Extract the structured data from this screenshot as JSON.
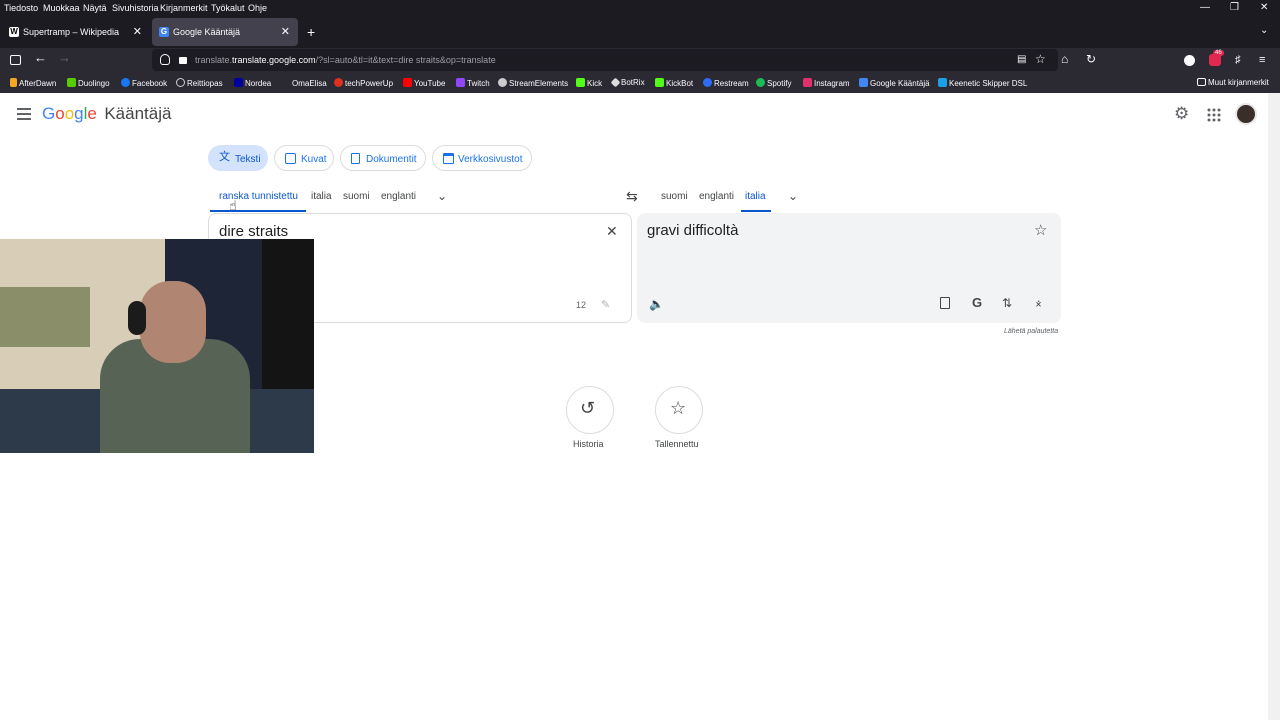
{
  "menubar": {
    "items": [
      "Tiedosto",
      "Muokkaa",
      "Näytä",
      "Sivuhistoria",
      "Kirjanmerkit",
      "Työkalut",
      "Ohje"
    ]
  },
  "tabs": [
    {
      "title": "Supertramp – Wikipedia",
      "favicon": "W"
    },
    {
      "title": "Google Kääntäjä",
      "favicon": "G"
    }
  ],
  "url": {
    "host": "translate.google.com",
    "path": "/?sl=auto&tl=it&text=dire straits&op=translate",
    "prefix": "translate."
  },
  "extension_badge": "46",
  "bookmarks": [
    {
      "label": "AfterDawn",
      "color": "#f5a623"
    },
    {
      "label": "Duolingo",
      "color": "#58cc02"
    },
    {
      "label": "Facebook",
      "color": "#1877f2"
    },
    {
      "label": "Reittiopas",
      "color": "#cfcfcf"
    },
    {
      "label": "Nordea",
      "color": "#0000a0"
    },
    {
      "label": "OmaElisa",
      "color": "#2b2a33"
    },
    {
      "label": "techPowerUp",
      "color": "#e0301e"
    },
    {
      "label": "YouTube",
      "color": "#ff0000"
    },
    {
      "label": "Twitch",
      "color": "#9146ff"
    },
    {
      "label": "StreamElements",
      "color": "#cccccc"
    },
    {
      "label": "Kick",
      "color": "#53fc18"
    },
    {
      "label": "BotRix",
      "color": "#dddddd"
    },
    {
      "label": "KickBot",
      "color": "#53fc18"
    },
    {
      "label": "Restream",
      "color": "#2f6cf6"
    },
    {
      "label": "Spotify",
      "color": "#1db954"
    },
    {
      "label": "Instagram",
      "color": "#e1306c"
    },
    {
      "label": "Google Kääntäjä",
      "color": "#4285f4"
    },
    {
      "label": "Keenetic Skipper DSL",
      "color": "#1aa0e6"
    }
  ],
  "other_bookmarks": "Muut kirjanmerkit",
  "app": {
    "logo_letters": [
      "G",
      "o",
      "o",
      "g",
      "l",
      "e"
    ],
    "logo_colors": [
      "#4285f4",
      "#ea4335",
      "#fbbc05",
      "#4285f4",
      "#34a853",
      "#ea4335"
    ],
    "name": "Kääntäjä"
  },
  "modes": [
    "Teksti",
    "Kuvat",
    "Dokumentit",
    "Verkkosivustot"
  ],
  "source_langs": [
    "ranska tunnistettu",
    "italia",
    "suomi",
    "englanti"
  ],
  "target_langs": [
    "suomi",
    "englanti",
    "italia"
  ],
  "source": {
    "text": "dire straits",
    "char_count": "12"
  },
  "target": {
    "text": "gravi difficoltà"
  },
  "feedback": "Lähetä palautetta",
  "history_label": "Historia",
  "saved_label": "Tallennettu",
  "colors": {
    "accent": "#1a73e8",
    "chip_active": "#d3e3fd",
    "panel": "#f1f3f4"
  }
}
